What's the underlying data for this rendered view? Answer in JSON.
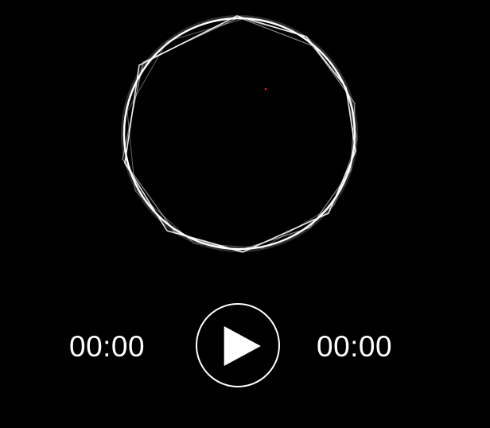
{
  "player": {
    "elapsed_time": "00:00",
    "total_time": "00:00",
    "play_icon": "play-icon",
    "accent_color": "#ffffff",
    "background_color": "#000000",
    "marker_color": "#d11a1a"
  }
}
